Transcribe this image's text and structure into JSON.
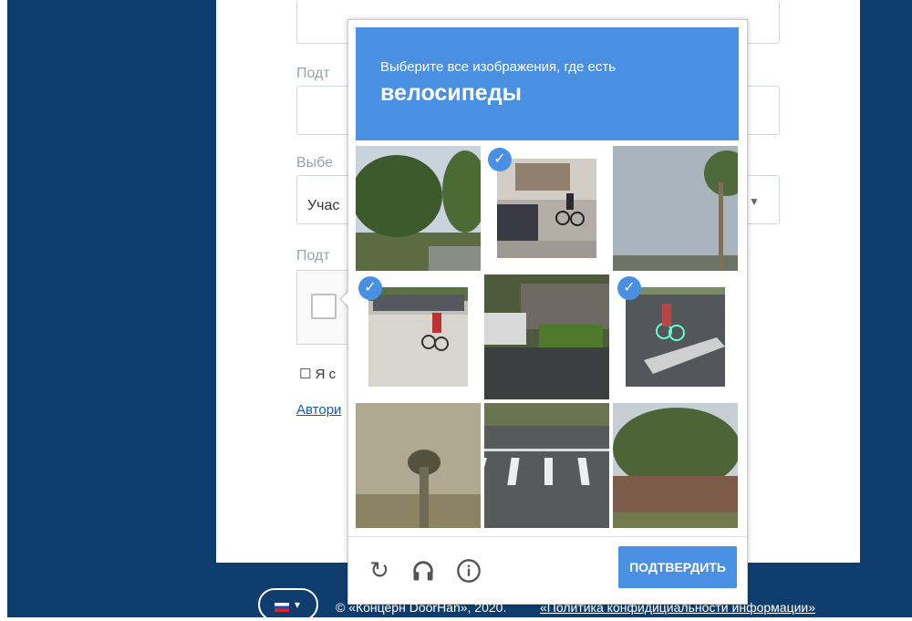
{
  "form": {
    "label_confirm_1": "Подт",
    "label_select": "Выбе",
    "select_value": "Учас",
    "label_confirm_2": "Подт",
    "agree_text": "☐ Я с",
    "auth_link": "Автори"
  },
  "captcha": {
    "instruction": "Выберите все изображения, где есть",
    "object": "велосипеды",
    "verify_label": "ПОДТВЕРДИТЬ",
    "icons": [
      "reload-icon",
      "audio-icon",
      "info-icon"
    ],
    "accent": "#4a90e2",
    "tiles": [
      {
        "selected": false,
        "desc": "trees"
      },
      {
        "selected": true,
        "desc": "bicycle-driveway"
      },
      {
        "selected": false,
        "desc": "palm-sky"
      },
      {
        "selected": true,
        "desc": "bicycle-street"
      },
      {
        "selected": false,
        "desc": "truck-house"
      },
      {
        "selected": true,
        "desc": "bicycle-crosswalk"
      },
      {
        "selected": false,
        "desc": "blurry-palm"
      },
      {
        "selected": false,
        "desc": "crosswalk-road"
      },
      {
        "selected": false,
        "desc": "tree-house"
      }
    ]
  },
  "footer": {
    "copyright": "© «Концерн DoorHan», 2020.",
    "privacy": "«Политика конфидициальности информации»"
  },
  "colors": {
    "background": "#0f3e6e"
  }
}
